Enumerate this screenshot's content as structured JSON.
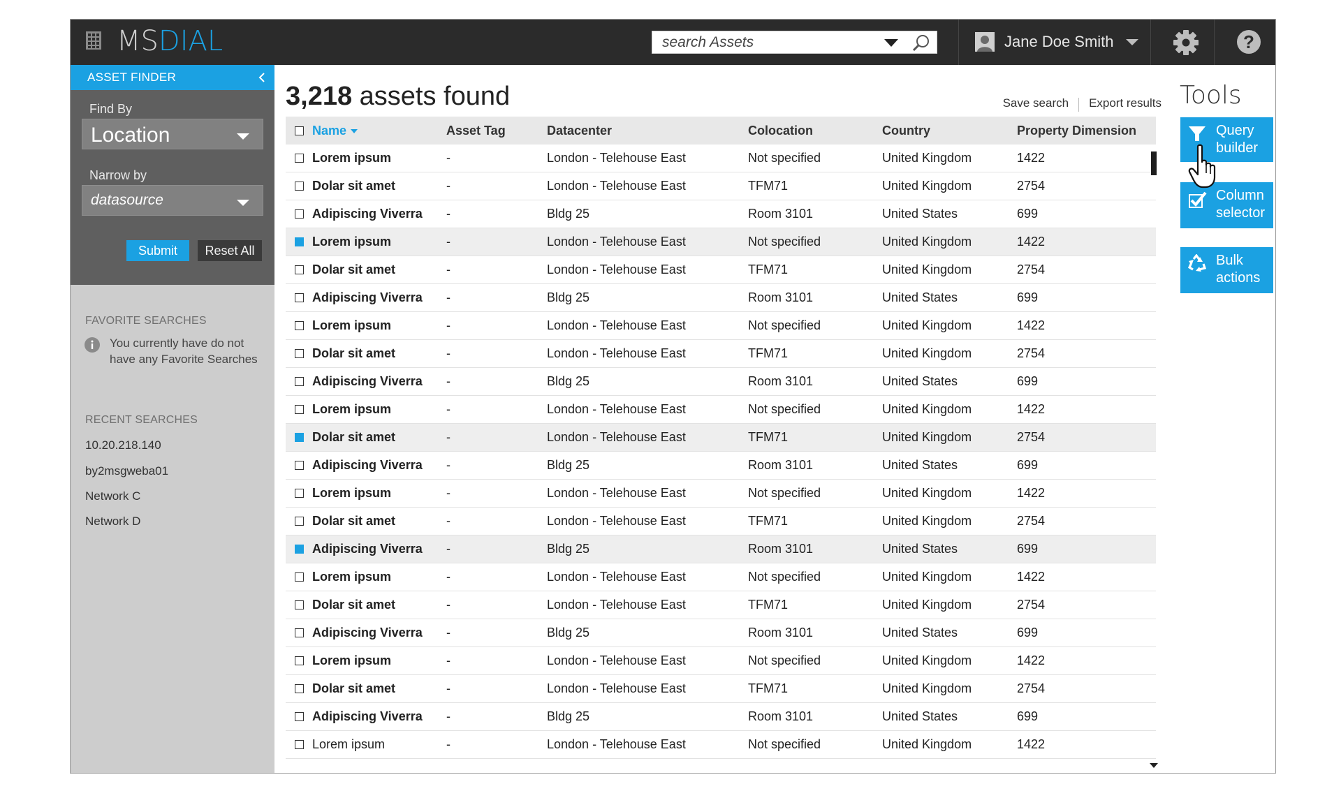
{
  "app": {
    "logo_ms": "MS",
    "logo_dial": "DIAL",
    "brand_color": "#1ba1e2"
  },
  "header": {
    "search_placeholder": "search Assets",
    "user_name": "Jane Doe Smith",
    "icons": [
      "grid-icon",
      "chevron-down-icon",
      "search-icon",
      "user-avatar-icon",
      "gear-icon",
      "help-icon"
    ]
  },
  "sidebar": {
    "finder_title": "ASSET FINDER",
    "find_by_label": "Find By",
    "find_by_value": "Location",
    "narrow_by_label": "Narrow by",
    "narrow_by_value": "datasource",
    "submit_label": "Submit",
    "reset_label": "Reset All",
    "favorites_title": "FAVORITE SEARCHES",
    "favorites_empty": "You currently have do not have any Favorite Searches",
    "recent_title": "RECENT SEARCHES",
    "recent": [
      "10.20.218.140",
      "by2msgweba01",
      "Network C",
      "Network D"
    ]
  },
  "main": {
    "count": "3,218",
    "count_suffix": "assets found",
    "save_search": "Save search",
    "export_results": "Export results",
    "columns": [
      "Name",
      "Asset Tag",
      "Datacenter",
      "Colocation",
      "Country",
      "Property Dimension"
    ],
    "rows": [
      {
        "name": "Lorem ipsum",
        "tag": "-",
        "dc": "London - Telehouse East",
        "col": "Not specified",
        "country": "United Kingdom",
        "dim": "1422",
        "selected": false
      },
      {
        "name": "Dolar sit amet",
        "tag": "-",
        "dc": "London - Telehouse East",
        "col": "TFM71",
        "country": "United Kingdom",
        "dim": "2754",
        "selected": false
      },
      {
        "name": "Adipiscing Viverra",
        "tag": "-",
        "dc": "Bldg 25",
        "col": "Room 3101",
        "country": "United States",
        "dim": "699",
        "selected": false
      },
      {
        "name": "Lorem ipsum",
        "tag": "-",
        "dc": "London - Telehouse East",
        "col": "Not specified",
        "country": "United Kingdom",
        "dim": "1422",
        "selected": true
      },
      {
        "name": "Dolar sit amet",
        "tag": "-",
        "dc": "London - Telehouse East",
        "col": "TFM71",
        "country": "United Kingdom",
        "dim": "2754",
        "selected": false
      },
      {
        "name": "Adipiscing Viverra",
        "tag": "-",
        "dc": "Bldg 25",
        "col": "Room 3101",
        "country": "United States",
        "dim": "699",
        "selected": false
      },
      {
        "name": "Lorem ipsum",
        "tag": "-",
        "dc": "London - Telehouse East",
        "col": "Not specified",
        "country": "United Kingdom",
        "dim": "1422",
        "selected": false
      },
      {
        "name": "Dolar sit amet",
        "tag": "-",
        "dc": "London - Telehouse East",
        "col": "TFM71",
        "country": "United Kingdom",
        "dim": "2754",
        "selected": false
      },
      {
        "name": "Adipiscing Viverra",
        "tag": "-",
        "dc": "Bldg 25",
        "col": "Room 3101",
        "country": "United States",
        "dim": "699",
        "selected": false
      },
      {
        "name": "Lorem ipsum",
        "tag": "-",
        "dc": "London - Telehouse East",
        "col": "Not specified",
        "country": "United Kingdom",
        "dim": "1422",
        "selected": false
      },
      {
        "name": "Dolar sit amet",
        "tag": "-",
        "dc": "London - Telehouse East",
        "col": "TFM71",
        "country": "United Kingdom",
        "dim": "2754",
        "selected": true
      },
      {
        "name": "Adipiscing Viverra",
        "tag": "-",
        "dc": "Bldg 25",
        "col": "Room 3101",
        "country": "United States",
        "dim": "699",
        "selected": false
      },
      {
        "name": "Lorem ipsum",
        "tag": "-",
        "dc": "London - Telehouse East",
        "col": "Not specified",
        "country": "United Kingdom",
        "dim": "1422",
        "selected": false
      },
      {
        "name": "Dolar sit amet",
        "tag": "-",
        "dc": "London - Telehouse East",
        "col": "TFM71",
        "country": "United Kingdom",
        "dim": "2754",
        "selected": false
      },
      {
        "name": "Adipiscing Viverra",
        "tag": "-",
        "dc": "Bldg 25",
        "col": "Room 3101",
        "country": "United States",
        "dim": "699",
        "selected": true
      },
      {
        "name": "Lorem ipsum",
        "tag": "-",
        "dc": "London - Telehouse East",
        "col": "Not specified",
        "country": "United Kingdom",
        "dim": "1422",
        "selected": false
      },
      {
        "name": "Dolar sit amet",
        "tag": "-",
        "dc": "London - Telehouse East",
        "col": "TFM71",
        "country": "United Kingdom",
        "dim": "2754",
        "selected": false
      },
      {
        "name": "Adipiscing Viverra",
        "tag": "-",
        "dc": "Bldg 25",
        "col": "Room 3101",
        "country": "United States",
        "dim": "699",
        "selected": false
      },
      {
        "name": "Lorem ipsum",
        "tag": "-",
        "dc": "London - Telehouse East",
        "col": "Not specified",
        "country": "United Kingdom",
        "dim": "1422",
        "selected": false
      },
      {
        "name": "Dolar sit amet",
        "tag": "-",
        "dc": "London - Telehouse East",
        "col": "TFM71",
        "country": "United Kingdom",
        "dim": "2754",
        "selected": false
      },
      {
        "name": "Adipiscing Viverra",
        "tag": "-",
        "dc": "Bldg 25",
        "col": "Room 3101",
        "country": "United States",
        "dim": "699",
        "selected": false
      },
      {
        "name": "Lorem ipsum",
        "tag": "-",
        "dc": "London - Telehouse East",
        "col": "Not specified",
        "country": "United Kingdom",
        "dim": "1422",
        "selected": false,
        "plain": true
      }
    ]
  },
  "tools": {
    "title": "Tools",
    "items": [
      {
        "line1": "Query",
        "line2": "builder",
        "icon": "filter-icon"
      },
      {
        "line1": "Column",
        "line2": "selector",
        "icon": "checkbox-icon"
      },
      {
        "line1": "Bulk",
        "line2": "actions",
        "icon": "recycle-icon"
      }
    ]
  }
}
